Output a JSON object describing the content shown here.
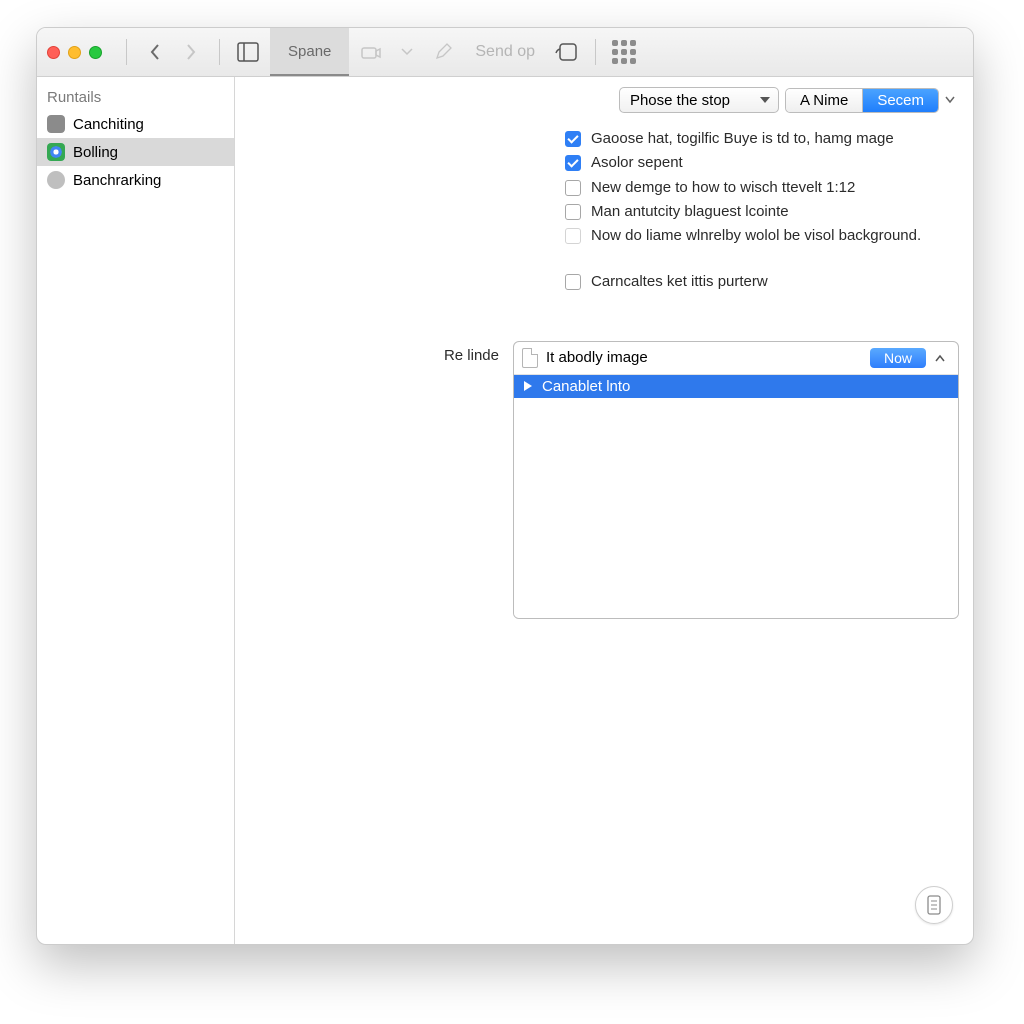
{
  "toolbar": {
    "tab_label": "Spane",
    "send_placeholder": "Send op"
  },
  "sidebar": {
    "header": "Runtails",
    "items": [
      {
        "label": "Canchiting"
      },
      {
        "label": "Bolling"
      },
      {
        "label": "Banchrarking"
      }
    ]
  },
  "topctrl": {
    "select_label": "Phose the stop",
    "seg_a": "A Nime",
    "seg_b": "Secem"
  },
  "options": [
    {
      "checked": true,
      "label": "Gaoose hat, togilfic Buye is td to, hamg mage"
    },
    {
      "checked": true,
      "label": "Asolor sepent"
    },
    {
      "checked": false,
      "label": "New demge to how to wisch ttevelt 1:12"
    },
    {
      "checked": false,
      "label": "Man antutcity blaguest lcointe"
    },
    {
      "checked": false,
      "label": "Now do liame wlnrelby wolol be visol background.",
      "dim": true
    }
  ],
  "extra_option": {
    "checked": false,
    "label": "Carncaltes ket ittis purterw"
  },
  "form": {
    "label": "Re linde",
    "panel_title": "It abodly image",
    "badge": "Now",
    "list": [
      {
        "label": "Canablet lnto"
      }
    ]
  }
}
